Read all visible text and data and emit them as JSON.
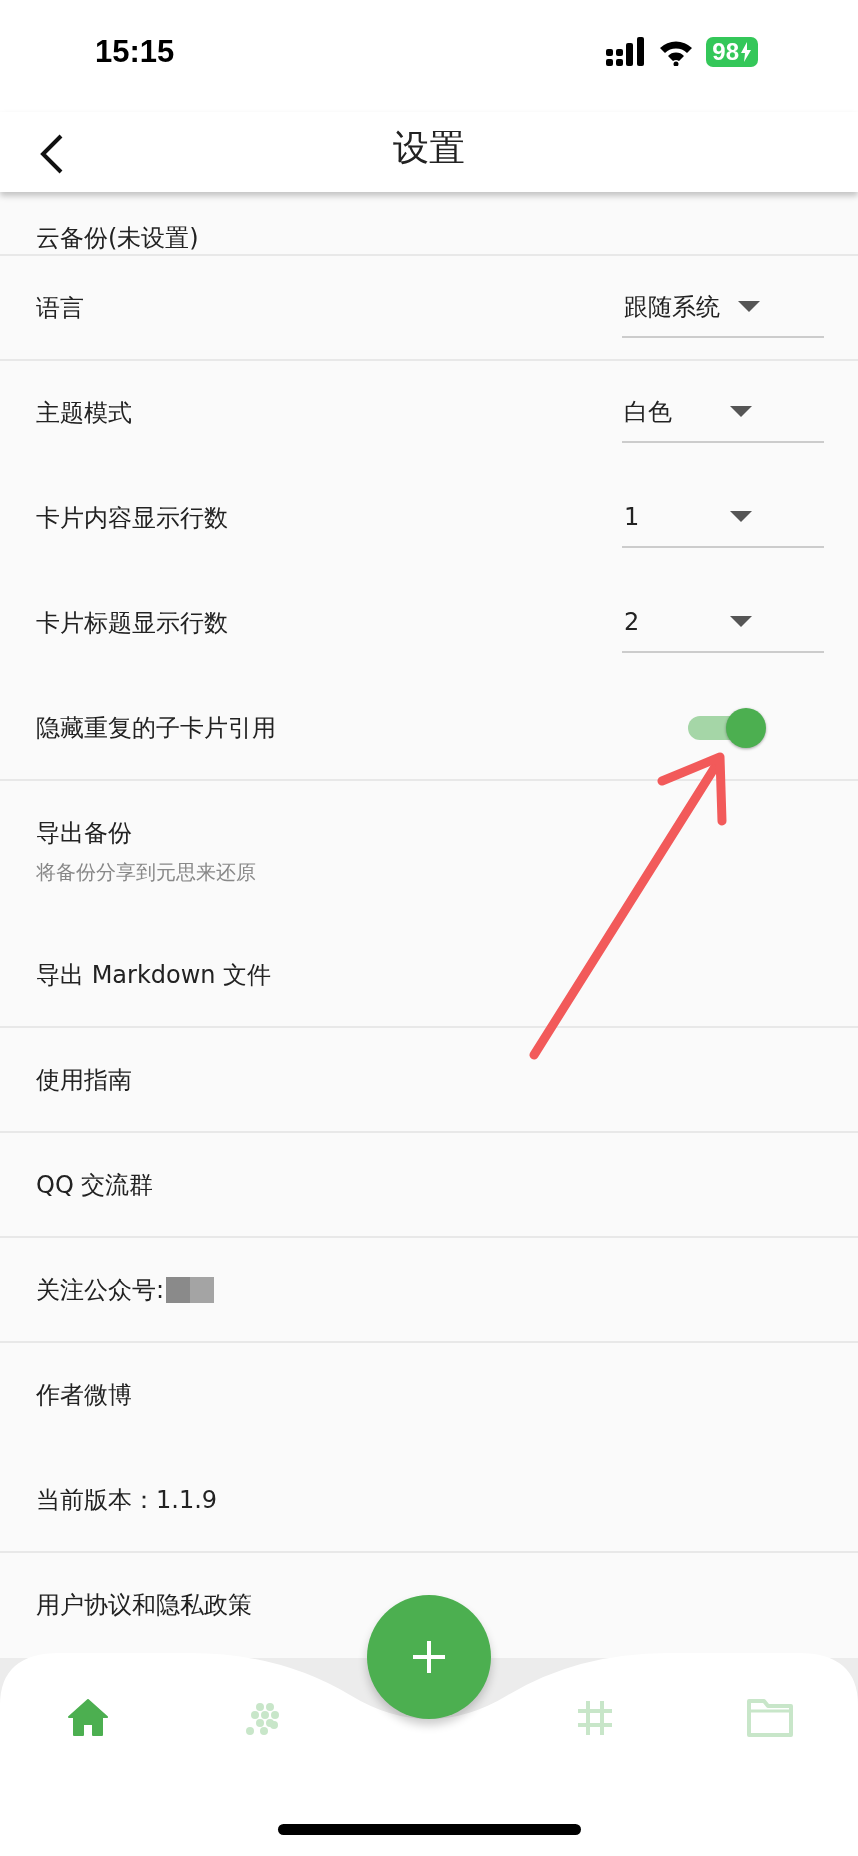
{
  "status_bar": {
    "time": "15:15",
    "battery": "98"
  },
  "header": {
    "title": "设置"
  },
  "settings": [
    {
      "kind": "plain",
      "label": "云备份(未设置)",
      "divider": true
    },
    {
      "kind": "dropdown",
      "label": "语言",
      "value": "跟随系统",
      "divider": true
    },
    {
      "kind": "dropdown",
      "label": "主题模式",
      "value": "白色",
      "divider": false
    },
    {
      "kind": "dropdown",
      "label": "卡片内容显示行数",
      "value": "1",
      "divider": false
    },
    {
      "kind": "dropdown",
      "label": "卡片标题显示行数",
      "value": "2",
      "divider": false
    },
    {
      "kind": "switch",
      "label": "隐藏重复的子卡片引用",
      "on": true,
      "divider": true
    },
    {
      "kind": "subtitle",
      "label": "导出备份",
      "subtitle": "将备份分享到元思来还原",
      "divider": false
    },
    {
      "kind": "plain",
      "label": "导出 Markdown 文件",
      "divider": true
    },
    {
      "kind": "plain",
      "label": "使用指南",
      "divider": true
    },
    {
      "kind": "plain",
      "label": "QQ 交流群",
      "divider": true
    },
    {
      "kind": "redacted",
      "label": "关注公众号:",
      "divider": true
    },
    {
      "kind": "plain",
      "label": "作者微博",
      "divider": false
    },
    {
      "kind": "plain",
      "label": "当前版本：1.1.9",
      "divider": true
    },
    {
      "kind": "plain",
      "label": "用户协议和隐私政策",
      "divider": false
    }
  ],
  "bottom_nav": [
    {
      "kind": "home",
      "selected": true
    },
    {
      "kind": "dots",
      "selected": false
    },
    {
      "kind": "hash",
      "selected": false
    },
    {
      "kind": "folder",
      "selected": false
    }
  ]
}
